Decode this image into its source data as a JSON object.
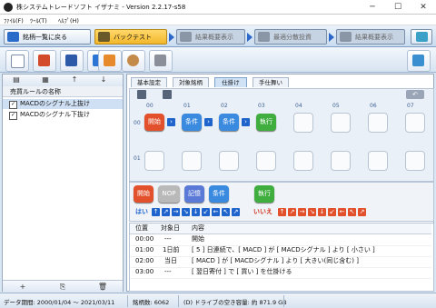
{
  "window": {
    "title": "株システムトレードソフト イザナミ - Version 2.2.17-s58"
  },
  "menu": [
    "ﾌｧｲﾙ(F)",
    "ﾂｰﾙ(T)",
    "ﾍﾙﾌﾟ(H)"
  ],
  "nav_tabs": {
    "back": "銘柄一覧に戻る",
    "backtest": "バックテスト",
    "summary1": "結果概要表示",
    "optimize": "最適分散投資",
    "summary2": "結果概要表示"
  },
  "left_panel": {
    "header": "売買ルールの名称",
    "rules": [
      {
        "label": "MACDのシグナル上抜け",
        "checked": true,
        "selected": true
      },
      {
        "label": "MACDのシグナル下抜け",
        "checked": true,
        "selected": false
      }
    ],
    "bottom_tools": [
      "+",
      "⎘",
      "🗑"
    ]
  },
  "sub_tabs": [
    "基本設定",
    "対象銘柄",
    "仕掛け",
    "手仕舞い"
  ],
  "grid": {
    "columns": [
      "00",
      "01",
      "02",
      "03",
      "04",
      "05",
      "06",
      "07"
    ],
    "rows": [
      "00",
      "01"
    ],
    "blocks": [
      {
        "label": "開始",
        "color": "#e2502c"
      },
      {
        "label": "条件",
        "color": "#3a8ae0"
      },
      {
        "label": "条件",
        "color": "#3a8ae0"
      },
      {
        "label": "執行",
        "color": "#3fae3f"
      }
    ]
  },
  "palette": {
    "blocks": [
      {
        "label": "開始",
        "color": "#e2502c"
      },
      {
        "label": "NOP",
        "color": "#b9b9b9"
      },
      {
        "label": "記憶",
        "color": "#5b79d6"
      },
      {
        "label": "条件",
        "color": "#3a8ae0"
      },
      {
        "label": "執行",
        "color": "#3fae3f"
      }
    ],
    "yes_label": "はい",
    "no_label": "いいえ"
  },
  "log": {
    "headers": [
      "位置",
      "対象日",
      "内容"
    ],
    "rows": [
      {
        "pos": "00:00",
        "day": "---",
        "content": "開始"
      },
      {
        "pos": "01:00",
        "day": "1日前",
        "content": "[ 5 ] 日連続で、[ MACD ] が [ MACDシグナル ] より [ 小さい ]"
      },
      {
        "pos": "02:00",
        "day": "当日",
        "content": "[ MACD ] が [ MACDシグナル ] より [ 大きい(同じ含む) ]"
      },
      {
        "pos": "03:00",
        "day": "---",
        "content": "[ 翌日寄付 ] で [ 買い ] を仕掛ける"
      }
    ]
  },
  "status": {
    "period": "データ期間: 2000/01/04 〜 2021/03/11",
    "count": "銘柄数: 6062",
    "disk": "(D) ドライブの空き容量: 約 871.9 GB"
  }
}
